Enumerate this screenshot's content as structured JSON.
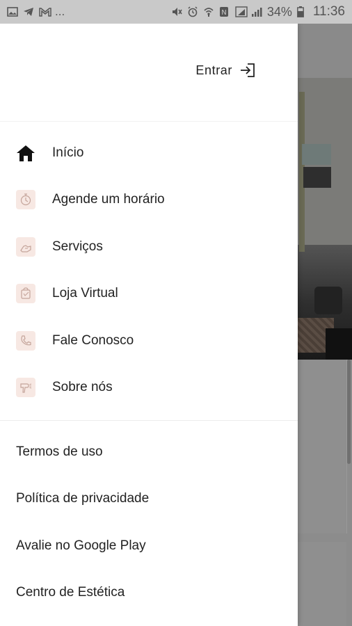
{
  "status_bar": {
    "left_icons": [
      "image-icon",
      "telegram-icon",
      "gmail-icon"
    ],
    "left_more": "...",
    "right_icons": [
      "mute-icon",
      "alarm-icon",
      "wifi-icon",
      "nfc-icon",
      "sim-icon",
      "signal-icon"
    ],
    "battery_percent": "34%",
    "time": "11:36"
  },
  "drawer": {
    "login_label": "Entrar",
    "login_icon": "login-icon",
    "primary_menu": [
      {
        "label": "Início",
        "icon": "home-icon"
      },
      {
        "label": "Agende um horário",
        "icon": "timer-icon"
      },
      {
        "label": "Serviços",
        "icon": "hand-icon"
      },
      {
        "label": "Loja Virtual",
        "icon": "store-icon"
      },
      {
        "label": "Fale Conosco",
        "icon": "phone-icon"
      },
      {
        "label": "Sobre nós",
        "icon": "dryer-icon"
      }
    ],
    "secondary_menu": [
      {
        "label": "Termos de uso"
      },
      {
        "label": "Política de privacidade"
      },
      {
        "label": "Avalie no Google Play"
      },
      {
        "label": "Centro de Estética"
      }
    ]
  },
  "colors": {
    "icon_tint_bg": "#f7e8e3",
    "icon_stroke": "#c4a49a",
    "text": "#222222",
    "overlay": "#8c8c8c"
  }
}
